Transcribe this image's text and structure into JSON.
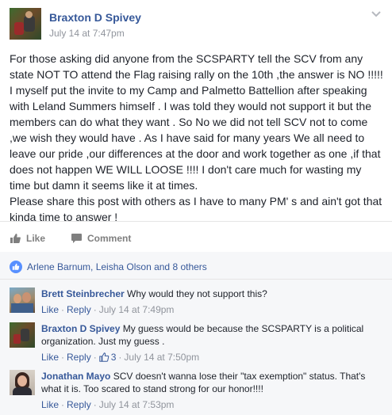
{
  "post": {
    "author": "Braxton D Spivey",
    "timestamp": "July 14 at 7:47pm",
    "body": [
      "For those asking did anyone from the SCSPARTY tell the SCV from any state NOT TO attend the Flag raising rally on the 10th ,the answer is NO !!!!! I myself put the invite to my Camp and Palmetto Battellion after speaking with Leland Summers himself . I was told they would not support it but the members can do what they want . So No we did not tell SCV not to come ,we wish they would have . As I have said for many years We all need to leave our pride ,our differences at the door and work together as one ,if that does not happen WE WILL LOOSE !!!! I don't care much for wasting my time but damn it seems like it at times.",
      "Please share this post with others as I have to many PM' s and ain't got that kinda time to answer !"
    ]
  },
  "actions": {
    "like_label": "Like",
    "comment_label": "Comment"
  },
  "likes_summary": "Arlene Barnum, Leisha Olson and 8 others",
  "comments": [
    {
      "name": "Brett Steinbrecher",
      "text": "Why would they not support this?",
      "like_label": "Like",
      "reply_label": "Reply",
      "time": "July 14 at 7:49pm",
      "reaction_count": ""
    },
    {
      "name": "Braxton D Spivey",
      "text": "My guess would be because the SCSPARTY is a political organization. Just my guess .",
      "like_label": "Like",
      "reply_label": "Reply",
      "time": "July 14 at 7:50pm",
      "reaction_count": "3"
    },
    {
      "name": "Jonathan Mayo",
      "text": "SCV doesn't wanna lose their \"tax exemption\" status. That's what it is. Too scared to stand strong for our honor!!!!",
      "like_label": "Like",
      "reply_label": "Reply",
      "time": "July 14 at 7:53pm",
      "reaction_count": ""
    }
  ],
  "separator": "·",
  "colors": {
    "link_blue": "#365899",
    "meta_gray": "#90949c",
    "comments_bg": "#f6f7f9"
  },
  "icons": {
    "options": "chevron-down-icon",
    "like": "thumbs-up-icon",
    "comment": "speech-bubble-icon",
    "likes_summary": "thumbs-up-badge-icon",
    "reaction": "thumbs-up-outline-icon"
  }
}
